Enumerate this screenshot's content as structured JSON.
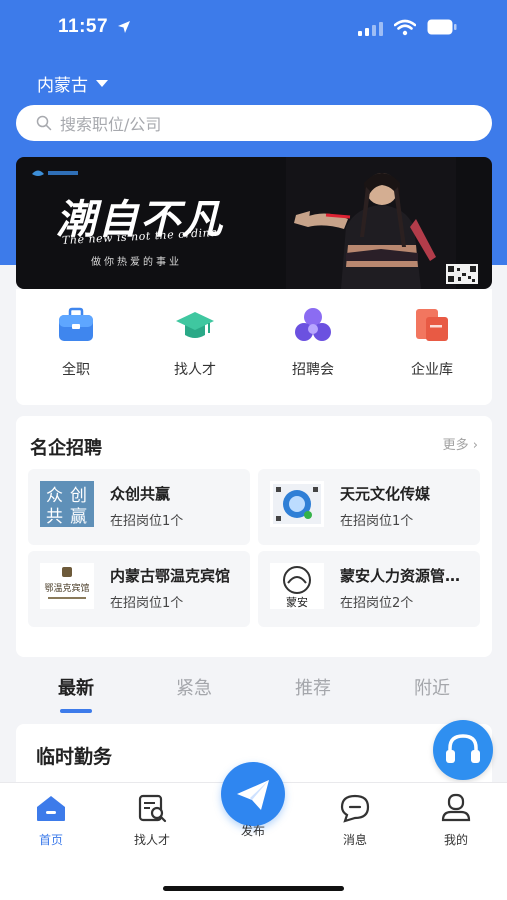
{
  "status_bar": {
    "time": "11:57"
  },
  "header": {
    "region": "内蒙古",
    "search_placeholder": "搜索职位/公司"
  },
  "banner": {
    "headline": "潮自不凡",
    "english": "The new is not the ordina",
    "sub": "做你热爱的事业"
  },
  "quick_links": [
    {
      "label": "全职",
      "icon": "briefcase-icon"
    },
    {
      "label": "找人才",
      "icon": "graduation-cap-icon"
    },
    {
      "label": "招聘会",
      "icon": "group-circles-icon"
    },
    {
      "label": "企业库",
      "icon": "company-cards-icon"
    }
  ],
  "famous": {
    "title": "名企招聘",
    "more": "更多",
    "companies": [
      {
        "name": "众创共赢",
        "positions": "在招岗位1个",
        "logo_text": [
          "众",
          "创",
          "共",
          "赢"
        ]
      },
      {
        "name": "天元文化传媒",
        "positions": "在招岗位1个"
      },
      {
        "name": "内蒙古鄂温克宾馆",
        "positions": "在招岗位1个",
        "logo_text": "鄂温克宾馆"
      },
      {
        "name": "蒙安人力资源管理有限公司",
        "positions": "在招岗位2个",
        "logo_text": "蒙安"
      }
    ]
  },
  "tabs": [
    {
      "label": "最新",
      "active": true
    },
    {
      "label": "紧急",
      "active": false
    },
    {
      "label": "推荐",
      "active": false
    },
    {
      "label": "附近",
      "active": false
    }
  ],
  "section": {
    "title": "临时勤务"
  },
  "bottom_nav": {
    "items": [
      {
        "label": "首页",
        "icon": "home-icon",
        "active": true
      },
      {
        "label": "找人才",
        "icon": "resume-search-icon",
        "active": false
      },
      {
        "label": "发布",
        "icon": "paper-plane-icon",
        "active": false
      },
      {
        "label": "消息",
        "icon": "message-icon",
        "active": false
      },
      {
        "label": "我的",
        "icon": "user-icon",
        "active": false
      }
    ]
  },
  "colors": {
    "primary": "#3d7bea",
    "publish": "#2f86f0",
    "background": "#f3f4f7"
  }
}
